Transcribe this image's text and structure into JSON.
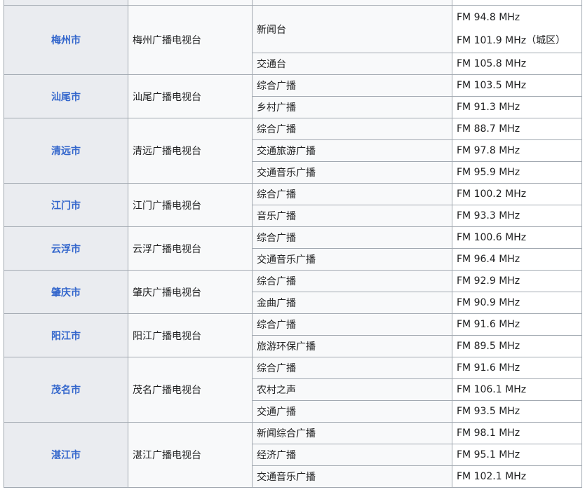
{
  "cities": [
    {
      "city": "",
      "org": "",
      "channels": [
        {
          "name": "",
          "freqs": [
            ""
          ]
        }
      ]
    },
    {
      "city": "梅州市",
      "org": "梅州广播电视台",
      "channels": [
        {
          "name": "新闻台",
          "freqs": [
            "FM 94.8 MHz",
            "FM 101.9 MHz（城区）"
          ]
        },
        {
          "name": "交通台",
          "freqs": [
            "FM 105.8 MHz"
          ]
        }
      ]
    },
    {
      "city": "汕尾市",
      "org": "汕尾广播电视台",
      "channels": [
        {
          "name": "综合广播",
          "freqs": [
            "FM 103.5 MHz"
          ]
        },
        {
          "name": "乡村广播",
          "freqs": [
            "FM 91.3 MHz"
          ]
        }
      ]
    },
    {
      "city": "清远市",
      "org": "清远广播电视台",
      "channels": [
        {
          "name": "综合广播",
          "freqs": [
            "FM 88.7 MHz"
          ]
        },
        {
          "name": "交通旅游广播",
          "freqs": [
            "FM 97.8 MHz"
          ]
        },
        {
          "name": "交通音乐广播",
          "freqs": [
            "FM 95.9 MHz"
          ]
        }
      ]
    },
    {
      "city": "江门市",
      "org": "江门广播电视台",
      "channels": [
        {
          "name": "综合广播",
          "freqs": [
            "FM 100.2 MHz"
          ]
        },
        {
          "name": "音乐广播",
          "freqs": [
            "FM 93.3 MHz"
          ]
        }
      ]
    },
    {
      "city": "云浮市",
      "org": "云浮广播电视台",
      "channels": [
        {
          "name": "综合广播",
          "freqs": [
            "FM 100.6 MHz"
          ]
        },
        {
          "name": "交通音乐广播",
          "freqs": [
            "FM 96.4 MHz"
          ]
        }
      ]
    },
    {
      "city": "肇庆市",
      "org": "肇庆广播电视台",
      "channels": [
        {
          "name": "综合广播",
          "freqs": [
            "FM 92.9 MHz"
          ]
        },
        {
          "name": "金曲广播",
          "freqs": [
            "FM 90.9 MHz"
          ]
        }
      ]
    },
    {
      "city": "阳江市",
      "org": "阳江广播电视台",
      "channels": [
        {
          "name": "综合广播",
          "freqs": [
            "FM 91.6 MHz"
          ]
        },
        {
          "name": "旅游环保广播",
          "freqs": [
            "FM 89.5 MHz"
          ]
        }
      ]
    },
    {
      "city": "茂名市",
      "org": "茂名广播电视台",
      "channels": [
        {
          "name": "综合广播",
          "freqs": [
            "FM 91.6 MHz"
          ]
        },
        {
          "name": "农村之声",
          "freqs": [
            "FM 106.1 MHz"
          ]
        },
        {
          "name": "交通广播",
          "freqs": [
            "FM 93.5 MHz"
          ]
        }
      ]
    },
    {
      "city": "湛江市",
      "org": "湛江广播电视台",
      "channels": [
        {
          "name": "新闻综合广播",
          "freqs": [
            "FM 98.1 MHz"
          ]
        },
        {
          "name": "经济广播",
          "freqs": [
            "FM 95.1 MHz"
          ]
        },
        {
          "name": "交通音乐广播",
          "freqs": [
            "FM 102.1 MHz"
          ]
        }
      ]
    }
  ]
}
